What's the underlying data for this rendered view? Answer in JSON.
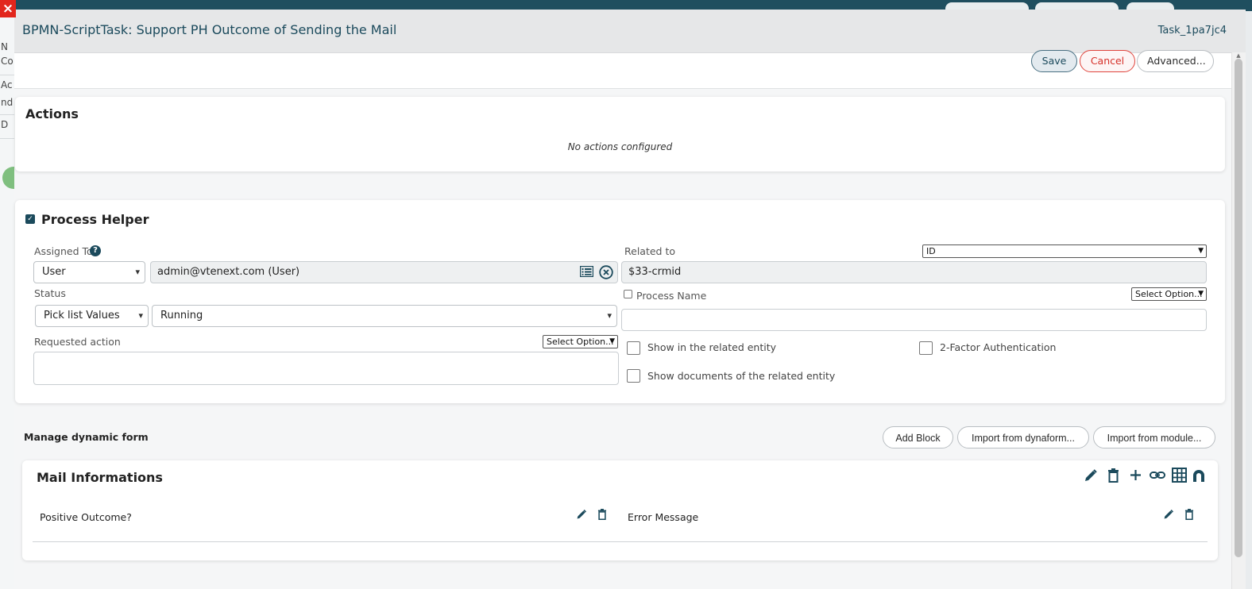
{
  "modal": {
    "title": "BPMN-ScriptTask: Support PH Outcome of Sending the Mail",
    "task_id": "Task_1pa7jc4"
  },
  "toolbar": {
    "save_label": "Save",
    "cancel_label": "Cancel",
    "advanced_label": "Advanced..."
  },
  "background": {
    "close_glyph": "×",
    "left_letters": [
      "N",
      "Co",
      "Ac",
      "nd",
      "D"
    ]
  },
  "actions": {
    "title": "Actions",
    "empty_text": "No actions configured"
  },
  "process_helper": {
    "title": "Process Helper",
    "enabled": true,
    "assigned_to": {
      "label": "Assigned To",
      "type_value": "User",
      "user_value": "admin@vtenext.com (User)"
    },
    "related_to": {
      "label": "Related to",
      "field_value": "ID",
      "value": "$33-crmid"
    },
    "status": {
      "label": "Status",
      "source_value": "Pick list Values",
      "value": "Running"
    },
    "process_name": {
      "label": "Process Name",
      "option_placeholder": "Select Option...",
      "checked": false
    },
    "requested_action": {
      "label": "Requested action",
      "option_placeholder": "Select Option..."
    },
    "checkboxes": {
      "show_related": "Show in the related entity",
      "two_factor": "2-Factor Authentication",
      "show_documents": "Show documents of the related entity"
    }
  },
  "dynamic_form": {
    "title": "Manage dynamic form",
    "add_block_label": "Add Block",
    "import_dynaform_label": "Import from dynaform...",
    "import_module_label": "Import from module...",
    "block": {
      "title": "Mail Informations",
      "fields": [
        "Positive Outcome?",
        "Error Message"
      ]
    }
  },
  "icons": {
    "help": "question-icon",
    "list": "list-icon",
    "clear": "clear-circle-icon",
    "edit": "pencil-icon",
    "delete": "trash-icon",
    "add": "plus-icon",
    "link": "link-icon",
    "table": "table-icon",
    "magnet": "magnet-icon"
  },
  "colors": {
    "brand": "#1b4a5c",
    "cancel": "#d6312a",
    "close": "#e2261c"
  }
}
